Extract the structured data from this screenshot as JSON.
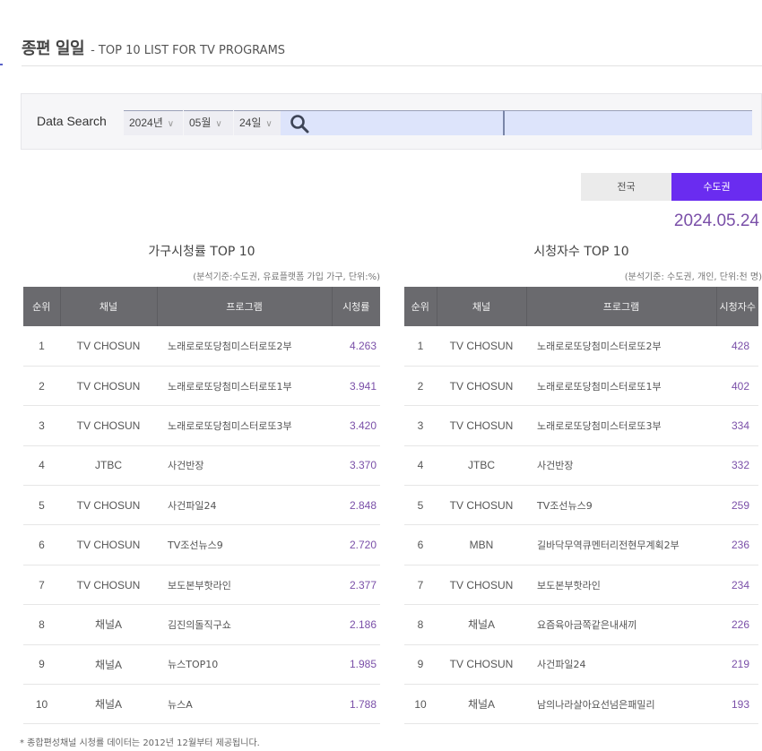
{
  "header": {
    "title_ko": "종편 일일",
    "title_en": "- TOP 10 LIST FOR TV PROGRAMS"
  },
  "search": {
    "label": "Data Search",
    "year": "2024년",
    "month": "05월",
    "day": "24일",
    "chevron": "∨",
    "search_icon": "search-icon"
  },
  "region_tabs": [
    {
      "label": "전국",
      "active": false
    },
    {
      "label": "수도권",
      "active": true
    }
  ],
  "date": "2024.05.24",
  "colors": {
    "accent": "#6a2cf0",
    "value_text": "#7a4fa8",
    "table_header": "#6a6a6e"
  },
  "household": {
    "title": "가구시청률 TOP 10",
    "note": "(분석기준:수도권, 유료플랫폼 가입 가구, 단위:%)",
    "columns": [
      "순위",
      "채널",
      "프로그램",
      "시청률"
    ],
    "rows": [
      {
        "rank": "1",
        "channel": "TV CHOSUN",
        "program": "노래로로또당첨미스터로또2부",
        "value": "4.263"
      },
      {
        "rank": "2",
        "channel": "TV CHOSUN",
        "program": "노래로로또당첨미스터로또1부",
        "value": "3.941"
      },
      {
        "rank": "3",
        "channel": "TV CHOSUN",
        "program": "노래로로또당첨미스터로또3부",
        "value": "3.420"
      },
      {
        "rank": "4",
        "channel": "JTBC",
        "program": "사건반장",
        "value": "3.370"
      },
      {
        "rank": "5",
        "channel": "TV CHOSUN",
        "program": "사건파일24",
        "value": "2.848"
      },
      {
        "rank": "6",
        "channel": "TV CHOSUN",
        "program": "TV조선뉴스9",
        "value": "2.720"
      },
      {
        "rank": "7",
        "channel": "TV CHOSUN",
        "program": "보도본부핫라인",
        "value": "2.377"
      },
      {
        "rank": "8",
        "channel": "채널A",
        "program": "김진의돌직구쇼",
        "value": "2.186"
      },
      {
        "rank": "9",
        "channel": "채널A",
        "program": "뉴스TOP10",
        "value": "1.985"
      },
      {
        "rank": "10",
        "channel": "채널A",
        "program": "뉴스A",
        "value": "1.788"
      }
    ]
  },
  "viewers": {
    "title": "시청자수 TOP 10",
    "note": "(분석기준: 수도권, 개인, 단위:천 명)",
    "columns": [
      "순위",
      "채널",
      "프로그램",
      "시청자수"
    ],
    "rows": [
      {
        "rank": "1",
        "channel": "TV CHOSUN",
        "program": "노래로로또당첨미스터로또2부",
        "value": "428"
      },
      {
        "rank": "2",
        "channel": "TV CHOSUN",
        "program": "노래로로또당첨미스터로또1부",
        "value": "402"
      },
      {
        "rank": "3",
        "channel": "TV CHOSUN",
        "program": "노래로로또당첨미스터로또3부",
        "value": "334"
      },
      {
        "rank": "4",
        "channel": "JTBC",
        "program": "사건반장",
        "value": "332"
      },
      {
        "rank": "5",
        "channel": "TV CHOSUN",
        "program": "TV조선뉴스9",
        "value": "259"
      },
      {
        "rank": "6",
        "channel": "MBN",
        "program": "길바닥무역큐멘터리전현무계획2부",
        "value": "236"
      },
      {
        "rank": "7",
        "channel": "TV CHOSUN",
        "program": "보도본부핫라인",
        "value": "234"
      },
      {
        "rank": "8",
        "channel": "채널A",
        "program": "요즘육아금쪽같은내새끼",
        "value": "226"
      },
      {
        "rank": "9",
        "channel": "TV CHOSUN",
        "program": "사건파일24",
        "value": "219"
      },
      {
        "rank": "10",
        "channel": "채널A",
        "program": "남의나라살아요선넘은패밀리",
        "value": "193"
      }
    ]
  },
  "footnote": "* 종합편성채널 시청률 데이터는 2012년 12월부터 제공됩니다."
}
